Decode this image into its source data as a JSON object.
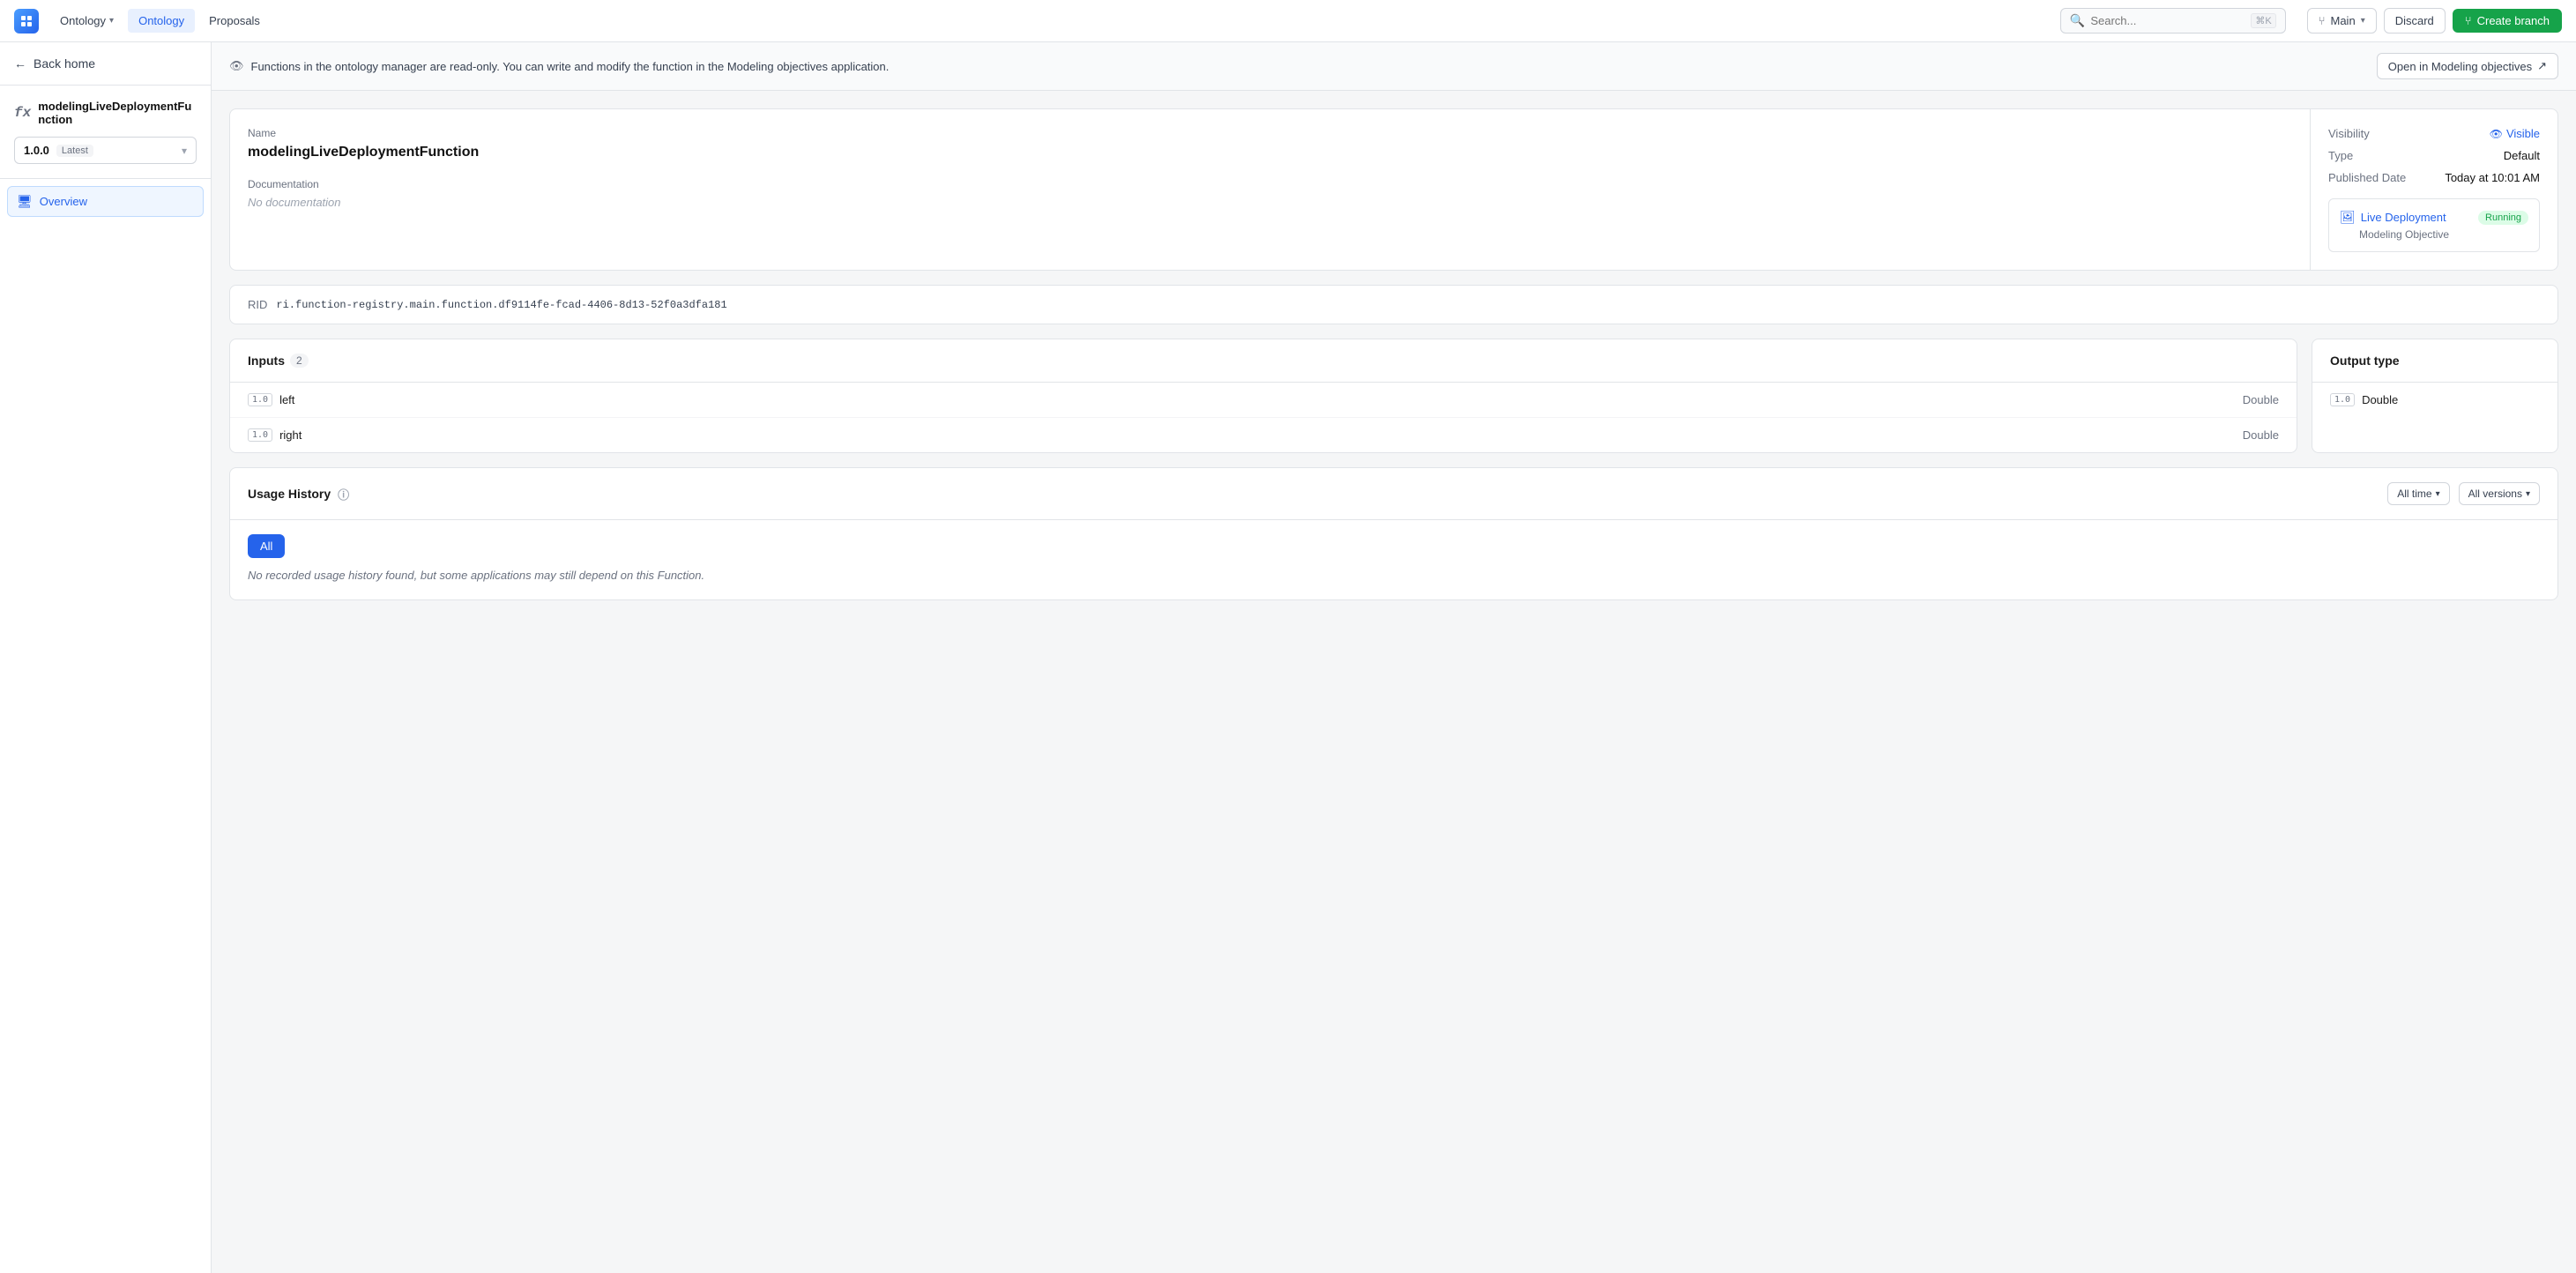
{
  "nav": {
    "logo_text": "P",
    "tabs": [
      {
        "label": "Ontology",
        "id": "ontology-parent",
        "has_dropdown": true,
        "active": false
      },
      {
        "label": "Ontology",
        "id": "ontology",
        "active": true
      },
      {
        "label": "Proposals",
        "id": "proposals",
        "active": false
      }
    ],
    "search_placeholder": "Search...",
    "kbd_shortcut": "⌘K",
    "branch_label": "Main",
    "discard_label": "Discard",
    "create_branch_label": "Create branch"
  },
  "sidebar": {
    "back_home_label": "Back home",
    "function_icon": "fx",
    "function_name": "modelingLiveDeploymentFunction",
    "version": "1.0.0",
    "version_tag": "Latest",
    "nav_items": [
      {
        "label": "Overview",
        "id": "overview",
        "active": true,
        "icon": "monitor"
      }
    ]
  },
  "info_banner": {
    "message": "Functions in the ontology manager are read-only. You can write and modify the function in the Modeling objectives application.",
    "open_btn_label": "Open in Modeling objectives",
    "open_btn_icon": "↗"
  },
  "function_detail": {
    "name_label": "Name",
    "name_value": "modelingLiveDeploymentFunction",
    "doc_label": "Documentation",
    "doc_placeholder": "No documentation",
    "visibility_label": "Visibility",
    "visibility_value": "Visible",
    "type_label": "Type",
    "type_value": "Default",
    "published_label": "Published Date",
    "published_value": "Today at 10:01 AM",
    "live_deploy_label": "Live Deployment",
    "live_deploy_subtitle": "Modeling Objective",
    "running_badge": "Running",
    "rid_label": "RID",
    "rid_value": "ri.function-registry.main.function.df9114fe-fcad-4406-8d13-52f0a3dfa181"
  },
  "inputs": {
    "header_label": "Inputs",
    "count": "2",
    "items": [
      {
        "name": "left",
        "type": "Double",
        "version": "1.0"
      },
      {
        "name": "right",
        "type": "Double",
        "version": "1.0"
      }
    ]
  },
  "output": {
    "header_label": "Output type",
    "type": "Double",
    "version": "1.0"
  },
  "usage_history": {
    "header_label": "Usage History",
    "filter_all_time": "All time",
    "filter_all_versions": "All versions",
    "all_tab_label": "All",
    "empty_message": "No recorded usage history found, but some applications may still depend on this Function."
  }
}
